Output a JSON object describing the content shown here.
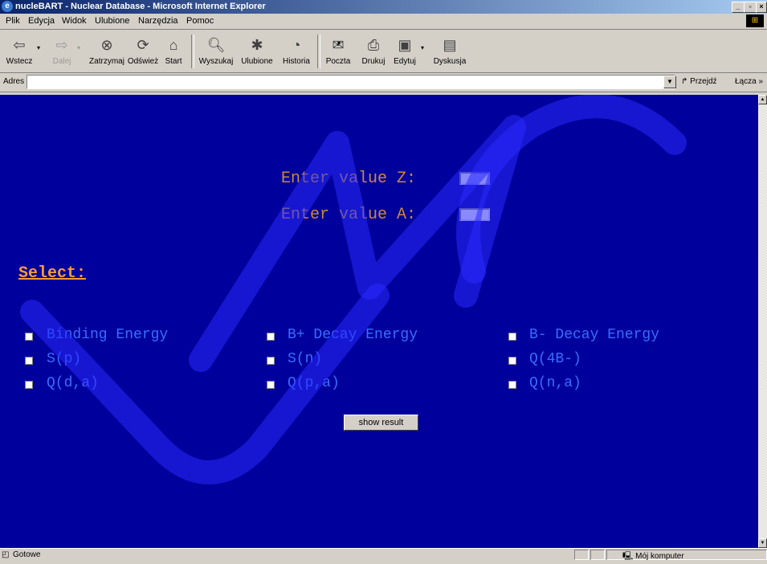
{
  "window": {
    "title": "nucleBART - Nuclear Database - Microsoft Internet Explorer"
  },
  "menu": [
    "Plik",
    "Edycja",
    "Widok",
    "Ulubione",
    "Narzędzia",
    "Pomoc"
  ],
  "toolbar": {
    "back": "Wstecz",
    "forward": "Dalej",
    "stop": "Zatrzymaj",
    "refresh": "Odśwież",
    "home": "Start",
    "search": "Wyszukaj",
    "favorites": "Ulubione",
    "history": "Historia",
    "mail": "Poczta",
    "print": "Drukuj",
    "edit": "Edytuj",
    "discuss": "Dyskusja"
  },
  "address": {
    "label": "Adres",
    "value": "",
    "go": "Przejdź",
    "links": "Łącza »"
  },
  "page": {
    "prompt_z": "Enter value Z:",
    "prompt_a": "Enter value A:",
    "select_label": "Select:",
    "options": [
      "Binding Energy",
      "B+ Decay Energy",
      "B- Decay Energy",
      "S(p)",
      "S(n)",
      "Q(4B-)",
      "Q(d,a)",
      "Q(p,a)",
      "Q(n,a)"
    ],
    "show_result": "show result",
    "watermark": "UMCS"
  },
  "status": {
    "text": "Gotowe",
    "zone": "Mój komputer"
  },
  "colors": {
    "page_bg": "#00009c",
    "prompt": "#cc8a3c",
    "select": "#ff9a33",
    "options": "#3a6dff"
  }
}
